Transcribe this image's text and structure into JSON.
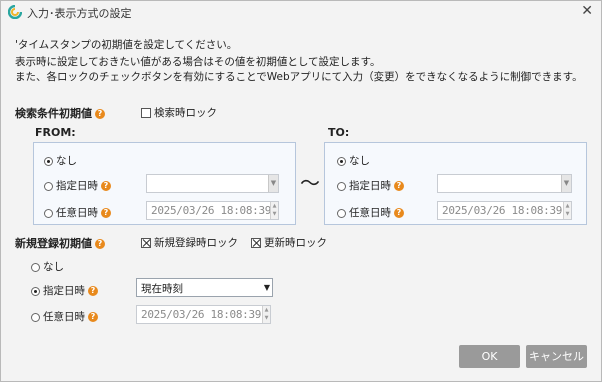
{
  "window": {
    "title": "入力･表示方式の設定"
  },
  "description": {
    "line1": "'タイムスタンプの初期値を設定してください。",
    "line2": "表示時に設定しておきたい値がある場合はその値を初期値として設定します。",
    "line3": "また、各ロックのチェックボタンを有効にすることでWebアプリにて入力（変更）をできなくなるように制御できます。"
  },
  "search": {
    "title": "検索条件初期値",
    "lock_label": "検索時ロック",
    "lock_checked": false,
    "from": {
      "label": "FROM:",
      "none_label": "なし",
      "specified_label": "指定日時",
      "specified_value": "",
      "arbitrary_label": "任意日時",
      "arbitrary_value": "2025/03/26 18:08:39",
      "selected": "none"
    },
    "tilde": "〜",
    "to": {
      "label": "TO:",
      "none_label": "なし",
      "specified_label": "指定日時",
      "specified_value": "",
      "arbitrary_label": "任意日時",
      "arbitrary_value": "2025/03/26 18:08:39",
      "selected": "none"
    }
  },
  "new_registration": {
    "title": "新規登録初期値",
    "new_lock_label": "新規登録時ロック",
    "new_lock_checked": true,
    "update_lock_label": "更新時ロック",
    "update_lock_checked": true,
    "none_label": "なし",
    "specified_label": "指定日時",
    "specified_value": "現在時刻",
    "arbitrary_label": "任意日時",
    "arbitrary_value": "2025/03/26 18:08:39",
    "selected": "specified"
  },
  "buttons": {
    "ok": "OK",
    "cancel": "キャンセル"
  },
  "icons": {
    "help": "?",
    "close": "✕",
    "dropdown": "▼"
  },
  "colors": {
    "help_badge": "#e8891c",
    "button_bg": "#9a9a9a",
    "panel_bg": "#f6f9fd",
    "panel_border": "#b6c6dc"
  }
}
